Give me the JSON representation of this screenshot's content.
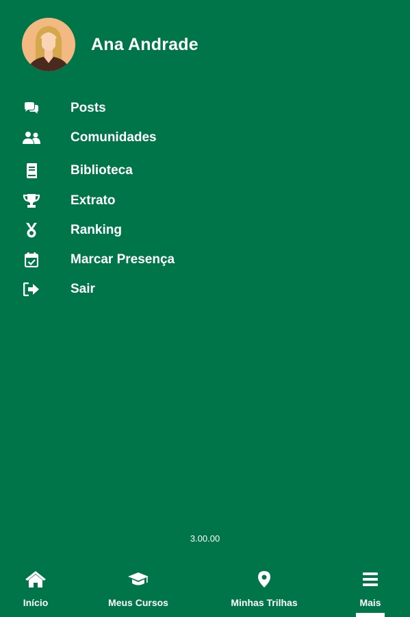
{
  "profile": {
    "name": "Ana Andrade",
    "avatar_icon": "user-avatar-female"
  },
  "menu": {
    "items": [
      {
        "label": "Posts",
        "icon": "comments-icon"
      },
      {
        "label": "Comunidades",
        "icon": "users-icon"
      },
      {
        "label": "Biblioteca",
        "icon": "book-icon"
      },
      {
        "label": "Extrato",
        "icon": "trophy-icon"
      },
      {
        "label": "Ranking",
        "icon": "medal-icon"
      },
      {
        "label": "Marcar Presença",
        "icon": "calendar-check-icon"
      },
      {
        "label": "Sair",
        "icon": "sign-out-icon"
      }
    ]
  },
  "app": {
    "version": "3.00.00"
  },
  "bottom_nav": {
    "items": [
      {
        "label": "Início",
        "icon": "home-icon"
      },
      {
        "label": "Meus Cursos",
        "icon": "graduation-cap-icon"
      },
      {
        "label": "Minhas Trilhas",
        "icon": "map-marker-icon"
      },
      {
        "label": "Mais",
        "icon": "menu-bars-icon",
        "active": true
      }
    ]
  },
  "colors": {
    "background": "#00754a",
    "foreground": "#ffffff",
    "avatar_bg": "#f3b982"
  }
}
